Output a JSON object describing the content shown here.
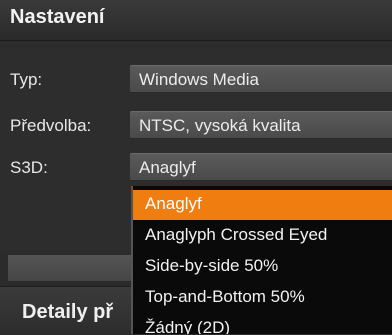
{
  "settings": {
    "title": "Nastavení",
    "rows": [
      {
        "label": "Typ:",
        "value": "Windows Media"
      },
      {
        "label": "Předvolba:",
        "value": "NTSC, vysoká kvalita"
      },
      {
        "label": "S3D:",
        "value": "Anaglyf"
      }
    ]
  },
  "dropdown": {
    "options": [
      "Anaglyf",
      "Anaglyph Crossed Eyed",
      "Side-by-side 50%",
      "Top-and-Bottom 50%",
      "Žádný (2D)"
    ],
    "selected": "Anaglyf",
    "highlight_color": "#f07d10"
  },
  "details": {
    "title": "Detaily př"
  }
}
